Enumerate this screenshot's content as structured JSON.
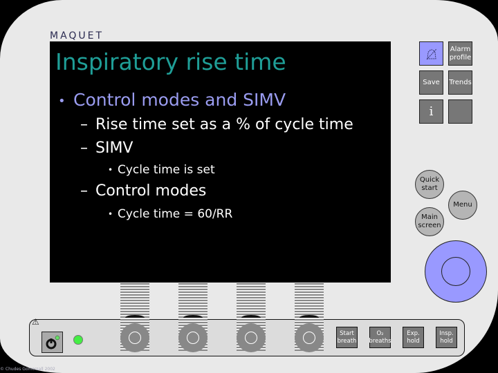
{
  "brand": "MAQUET",
  "slide": {
    "title": "Inspiratory rise time",
    "bullet": "Control modes and SIMV",
    "items": [
      {
        "level": 2,
        "text": "Rise time set as a % of cycle time"
      },
      {
        "level": 2,
        "text": "SIMV"
      },
      {
        "level": 3,
        "text": "Cycle time is set"
      },
      {
        "level": 2,
        "text": "Control modes"
      },
      {
        "level": 3,
        "text": "Cycle time = 60/RR"
      }
    ]
  },
  "right_panel": {
    "alarm_silence_icon": "bell-crossed-icon",
    "alarm_profile": "Alarm profile",
    "save": "Save",
    "trends": "Trends",
    "info": "i",
    "quick_start": "Quick start",
    "menu": "Menu",
    "main_screen": "Main screen"
  },
  "bottom_panel": {
    "start_breath": "Start breath",
    "o2_breaths": "O₂ breaths",
    "exp_hold": "Exp. hold",
    "insp_hold": "Insp. hold",
    "warning_icon": "⚠"
  },
  "copyright": "© Chudes Gomersall 2002",
  "colors": {
    "title": "#1f9e97",
    "bullet": "#9a9cf0",
    "accent_blue": "#9999ff",
    "led_green": "#44ee44"
  }
}
